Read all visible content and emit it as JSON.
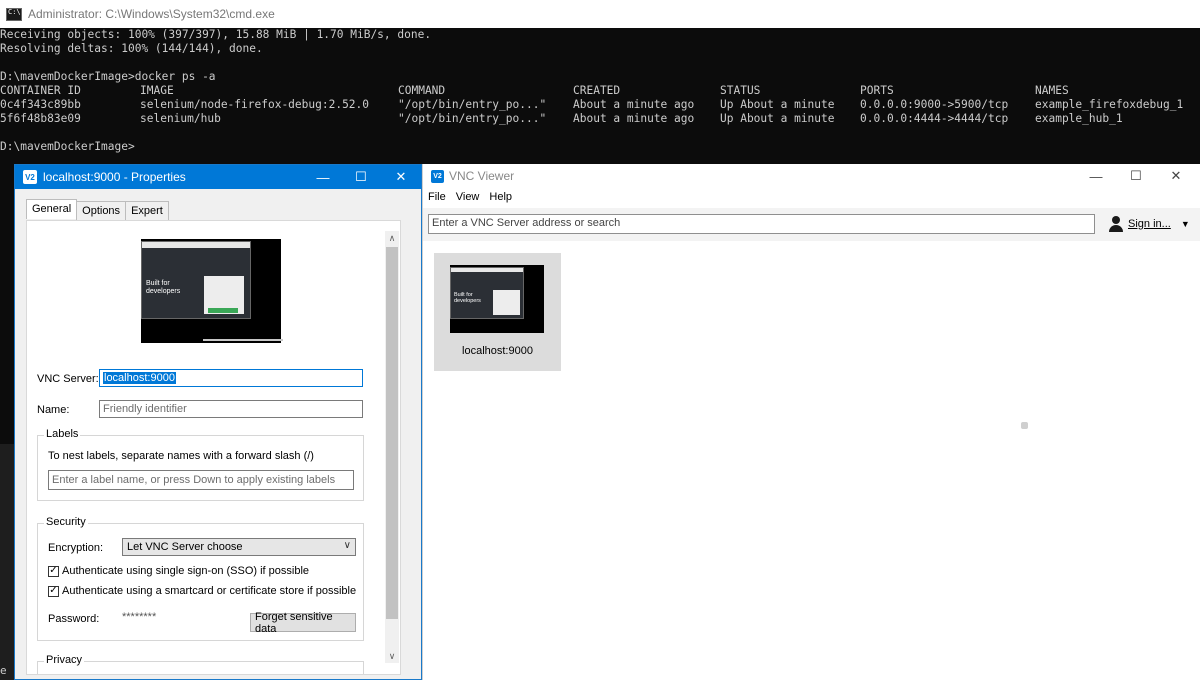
{
  "cmd": {
    "title": "Administrator: C:\\Windows\\System32\\cmd.exe",
    "lines": [
      "Receiving objects: 100% (397/397), 15.88 MiB | 1.70 MiB/s, done.",
      "Resolving deltas: 100% (144/144), done.",
      "D:\\mavemDockerImage>docker ps -a",
      "D:\\mavemDockerImage>"
    ],
    "table": {
      "headers": [
        "CONTAINER ID",
        "IMAGE",
        "COMMAND",
        "CREATED",
        "STATUS",
        "PORTS",
        "NAMES"
      ],
      "rows": [
        [
          "0c4f343c89bb",
          "selenium/node-firefox-debug:2.52.0",
          "\"/opt/bin/entry_po...\"",
          "About a minute ago",
          "Up About a minute",
          "0.0.0.0:9000->5900/tcp",
          "example_firefoxdebug_1"
        ],
        [
          "5f6f48b83e09",
          "selenium/hub",
          "\"/opt/bin/entry_po...\"",
          "About a minute ago",
          "Up About a minute",
          "0.0.0.0:4444->4444/tcp",
          "example_hub_1"
        ]
      ]
    },
    "tail_char": "e"
  },
  "properties": {
    "title": "localhost:9000 - Properties",
    "icon_text": "V2",
    "tabs": [
      "General",
      "Options",
      "Expert"
    ],
    "thumb_text": "Built for developers",
    "vnc_server_label": "VNC Server:",
    "vnc_server_value": "localhost:9000",
    "name_label": "Name:",
    "name_placeholder": "Friendly identifier",
    "labels_group": "Labels",
    "labels_hint": "To nest labels, separate names with a forward slash (/)",
    "labels_placeholder": "Enter a label name, or press Down to apply existing labels",
    "security_group": "Security",
    "encryption_label": "Encryption:",
    "encryption_value": "Let VNC Server choose",
    "sso_label": "Authenticate using single sign-on (SSO) if possible",
    "smartcard_label": "Authenticate using a smartcard or certificate store if possible",
    "password_label": "Password:",
    "password_value": "********",
    "forget_button": "Forget sensitive data",
    "privacy_group": "Privacy"
  },
  "vnc": {
    "title": "VNC Viewer",
    "icon_text": "V2",
    "menu": [
      "File",
      "View",
      "Help"
    ],
    "search_placeholder": "Enter a VNC Server address or search",
    "signin_label": "Sign in...",
    "tile_label": "localhost:9000",
    "tile_thumb_text": "Built for developers"
  },
  "window_controls": {
    "minimize": "—",
    "maximize": "☐",
    "close": "✕"
  },
  "colors": {
    "accent": "#0078d7",
    "console_bg": "#0c0c0c",
    "console_text": "#cccccc"
  }
}
